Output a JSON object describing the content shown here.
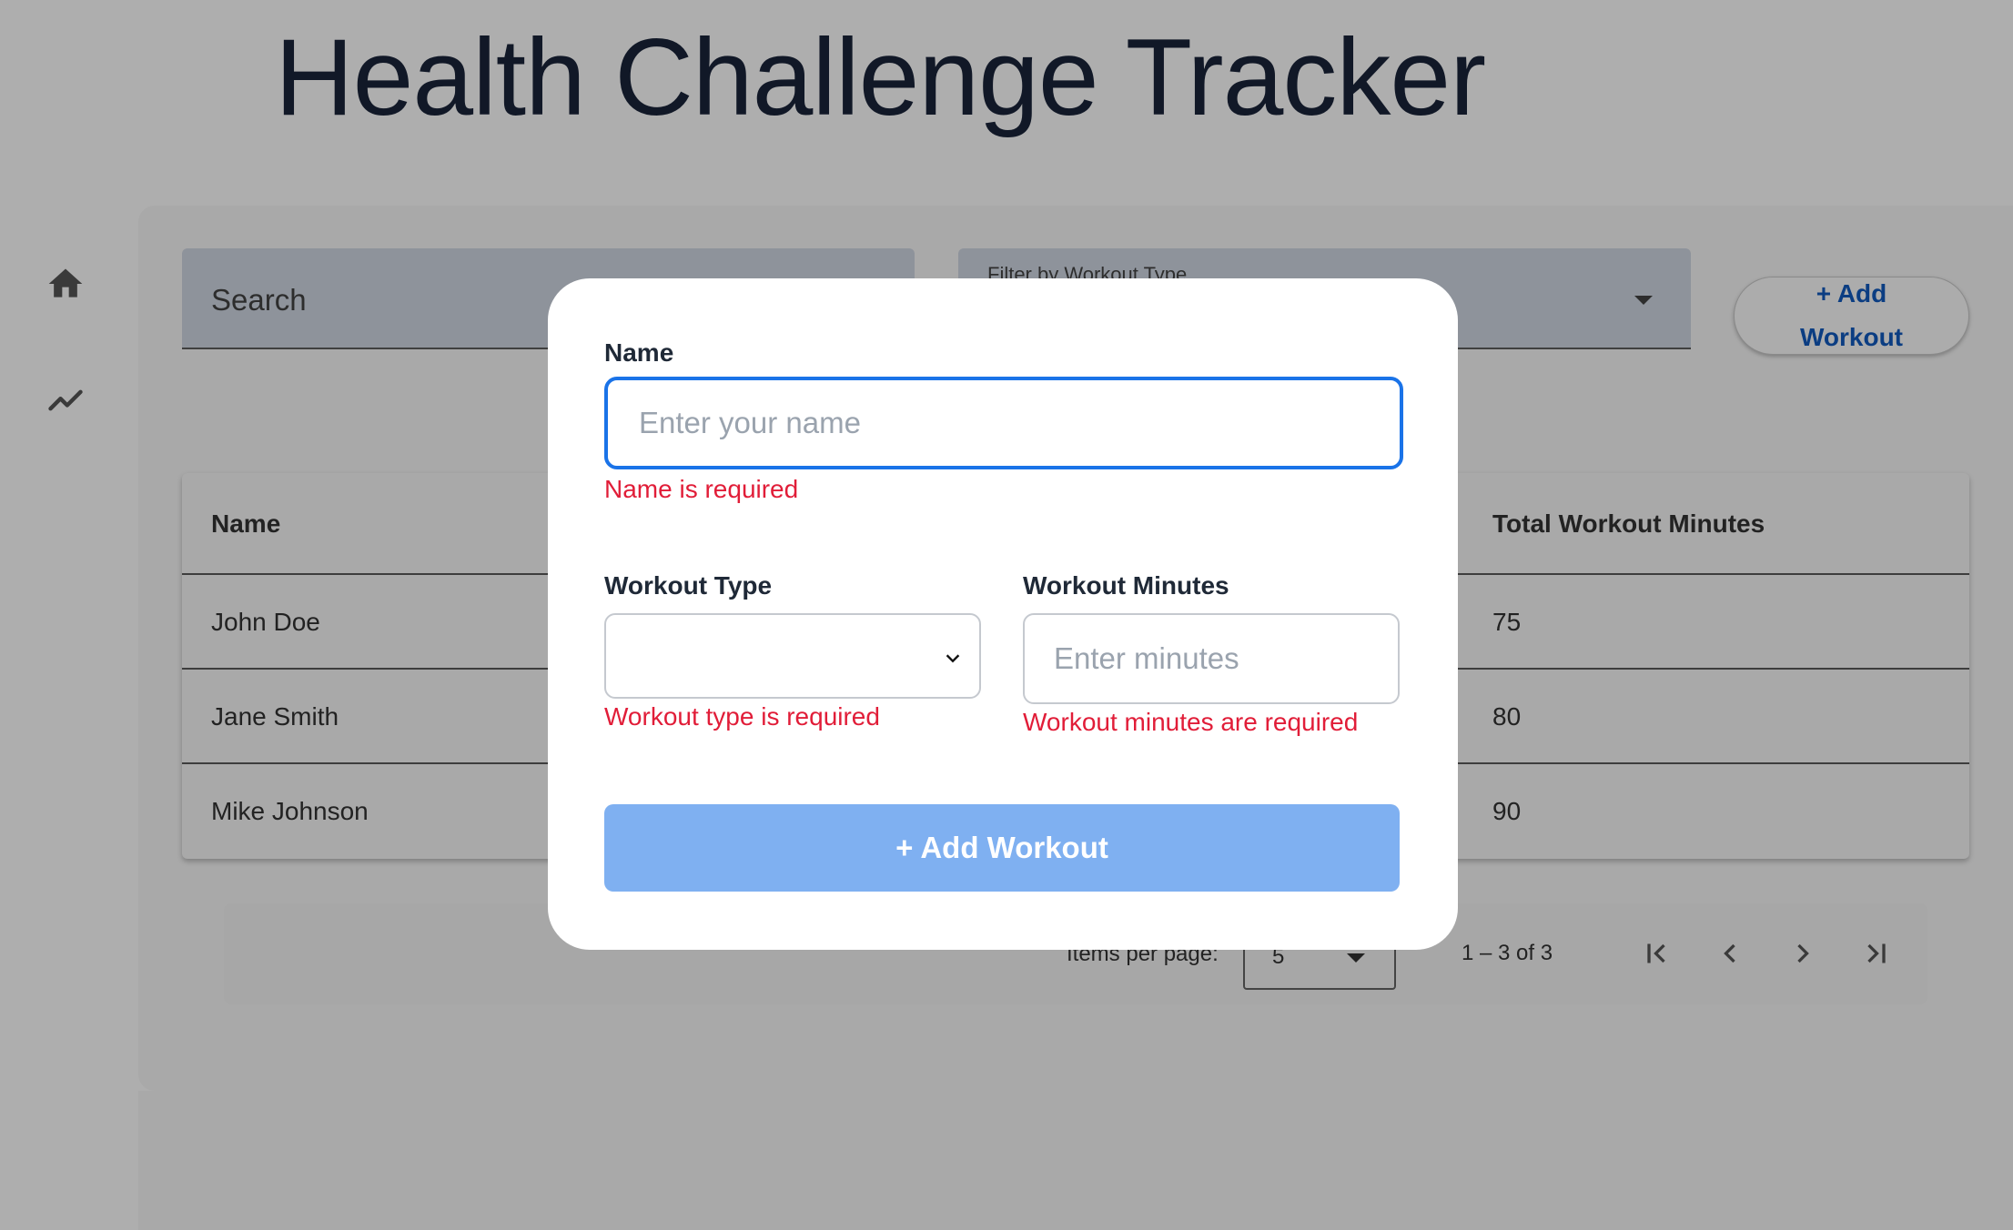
{
  "app": {
    "title": "Health Challenge Tracker"
  },
  "sidebar": {
    "items": [
      {
        "icon": "home-icon"
      },
      {
        "icon": "trending-icon"
      }
    ]
  },
  "toolbar": {
    "search_placeholder": "Search",
    "filter_label": "Filter by Workout Type",
    "add_button_line1": "+ Add",
    "add_button_line2": "Workout"
  },
  "table": {
    "columns": [
      "Name",
      "Total Workout Minutes"
    ],
    "rows": [
      {
        "name": "John Doe",
        "minutes": "75"
      },
      {
        "name": "Jane Smith",
        "minutes": "80"
      },
      {
        "name": "Mike Johnson",
        "minutes": "90"
      }
    ]
  },
  "paginator": {
    "items_label": "Items per page:",
    "page_size": "5",
    "range": "1 – 3 of 3"
  },
  "modal": {
    "name_label": "Name",
    "name_placeholder": "Enter your name",
    "name_error": "Name is required",
    "type_label": "Workout Type",
    "type_error": "Workout type is required",
    "minutes_label": "Workout Minutes",
    "minutes_placeholder": "Enter minutes",
    "minutes_error": "Workout minutes are required",
    "submit_label": "+ Add Workout"
  },
  "colors": {
    "accent": "#1a73e8",
    "error": "#e11d38",
    "submit_disabled": "#7fb0f1",
    "overlay": "#aeaeae"
  }
}
